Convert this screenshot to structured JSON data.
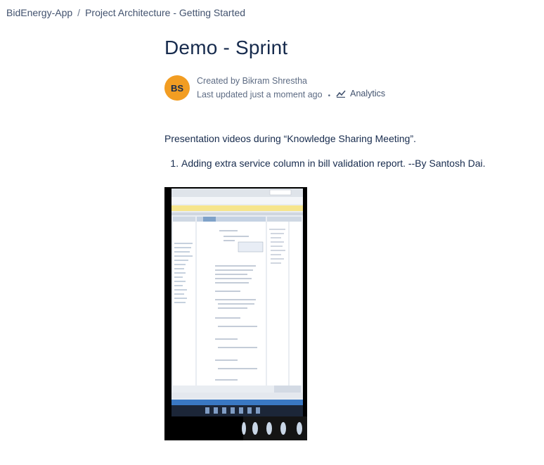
{
  "breadcrumb": {
    "space": "BidEnergy-App",
    "separator": "/",
    "parent": "Project Architecture - Getting Started"
  },
  "page": {
    "title": "Demo - Sprint"
  },
  "author": {
    "initials": "BS",
    "created_by": "Created by Bikram Shrestha",
    "updated": "Last updated just a moment ago",
    "dot": "•",
    "analytics_label": "Analytics",
    "avatar_color": "#f29d22"
  },
  "body": {
    "intro": "Presentation videos during “Knowledge Sharing Meeting”.",
    "list": [
      "Adding extra service column in bill validation report. --By Santosh Dai."
    ]
  },
  "attachment": {
    "type": "screenshot-image",
    "icon": "video-thumbnail"
  }
}
